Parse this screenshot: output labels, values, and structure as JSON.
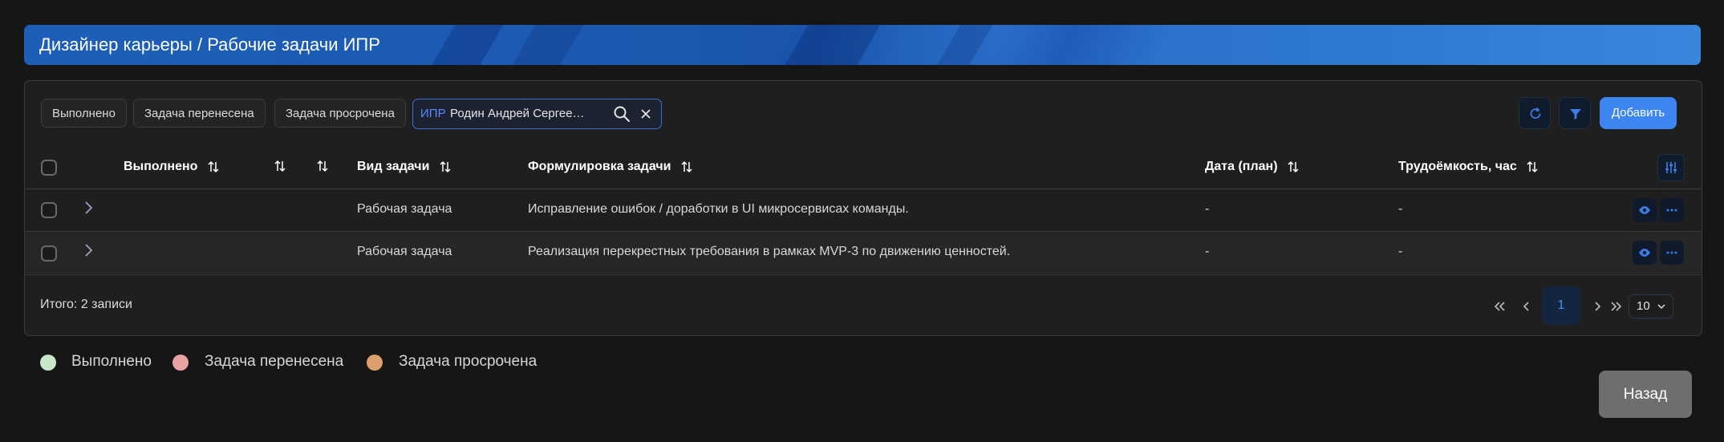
{
  "header": {
    "title": "Дизайнер карьеры / Рабочие задачи ИПР"
  },
  "filters": {
    "chips": [
      "Выполнено",
      "Задача перенесена",
      "Задача просрочена"
    ],
    "search": {
      "prefix": "ИПР",
      "value": "Родин Андрей Сергее…"
    }
  },
  "toolbar": {
    "add_label": "Добавить",
    "accent": "#3d85f0"
  },
  "table": {
    "columns": [
      "Выполнено",
      "Вид задачи",
      "Формулировка задачи",
      "Дата (план)",
      "Трудоёмкость, час"
    ],
    "rows": [
      {
        "type": "Рабочая задача",
        "text": "Исправление ошибок / доработки в UI микросервисах команды.",
        "date": "-",
        "effort": "-"
      },
      {
        "type": "Рабочая задача",
        "text": "Реализация перекрестных требования в рамках MVP-3 по движению ценностей.",
        "date": "-",
        "effort": "-"
      }
    ]
  },
  "footer": {
    "total": "Итого: 2 записи",
    "current_page": "1",
    "page_size": "10"
  },
  "legend": [
    {
      "label": "Выполнено",
      "color": "#c8e6c9"
    },
    {
      "label": "Задача перенесена",
      "color": "#e8a3a3"
    },
    {
      "label": "Задача просрочена",
      "color": "#dca06c"
    }
  ],
  "back_label": "Назад"
}
